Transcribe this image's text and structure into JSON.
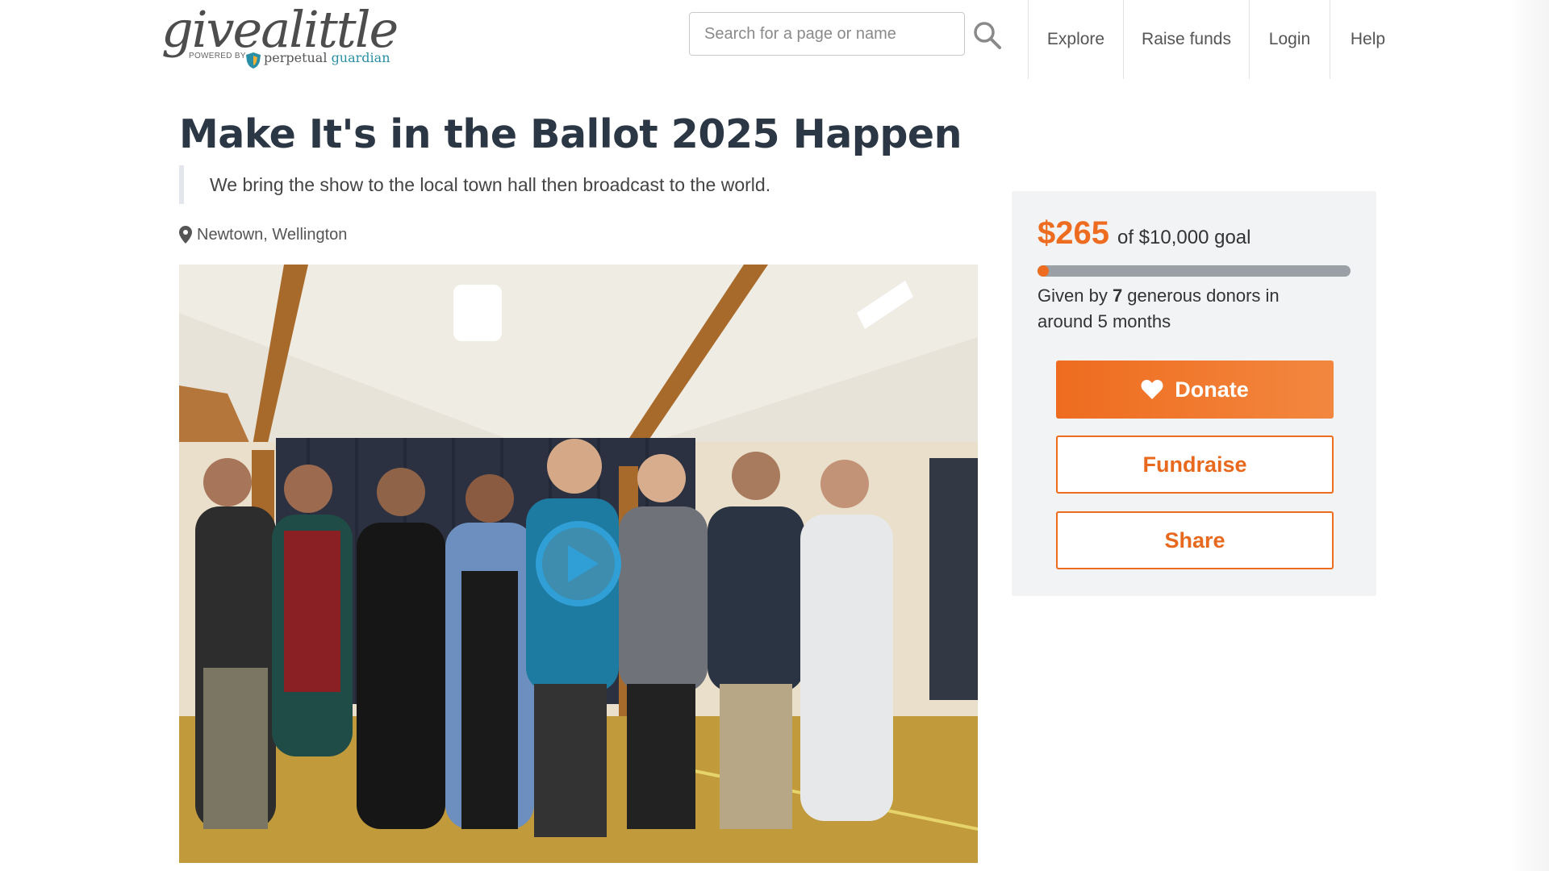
{
  "header": {
    "logo": {
      "word": "givealittle",
      "powered_by": "POWERED BY",
      "brand_a": "perpetual",
      "brand_b": "guardian"
    },
    "search": {
      "placeholder": "Search for a page or name",
      "icon": "search-icon"
    },
    "nav": [
      {
        "label": "Explore"
      },
      {
        "label": "Raise funds"
      },
      {
        "label": "Login"
      },
      {
        "label": "Help"
      }
    ]
  },
  "page": {
    "title": "Make It's in the Ballot 2025 Happen",
    "summary": "We bring the show to the local town hall then broadcast to the world.",
    "location": {
      "icon": "map-pin-icon",
      "text": "Newtown, Wellington"
    },
    "media": {
      "type": "video",
      "play_icon": "play-icon"
    }
  },
  "fundraising": {
    "raised": "$265",
    "goal_text": "of $10,000 goal",
    "progress_fraction": 0.0265,
    "donors_prefix": "Given by ",
    "donor_count": "7",
    "donors_suffix": " generous donors in around 5 months",
    "buttons": {
      "donate": "Donate",
      "fundraise": "Fundraise",
      "share": "Share"
    }
  },
  "colors": {
    "accent": "#ee6c1f",
    "title": "#2c3745",
    "card_bg": "#f1f3f5",
    "play": "#2f9fd6",
    "brand_teal": "#2a8fa6"
  }
}
